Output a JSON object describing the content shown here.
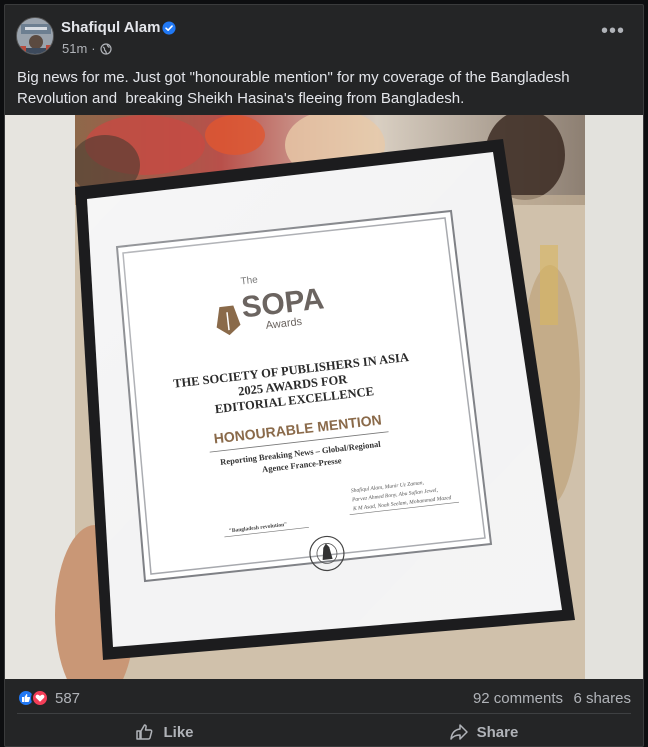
{
  "post": {
    "author": "Shafiqul Alam",
    "time": "51m",
    "separator": "·",
    "text": "Big news for me. Just got \"honourable mention\" for my coverage of the Bangladesh Revolution and  breaking Sheikh Hasina's fleeing from Bangladesh.",
    "more_label": "•••"
  },
  "certificate": {
    "brand_small": "The",
    "brand": "SOPA",
    "brand_sub": "Awards",
    "line1": "THE SOCIETY OF PUBLISHERS IN ASIA",
    "line2": "2025 AWARDS FOR",
    "line3": "EDITORIAL EXCELLENCE",
    "mention": "HONOURABLE MENTION",
    "category": "Reporting Breaking News – Global/Regional",
    "agency": "Agence France-Presse",
    "story": "\"Bangladesh revolution\"",
    "credits": [
      "Shafiqul Alam, Munir Uz Zaman,",
      "Parvez Ahmed Rony, Abu Sufian Jewel,",
      "K M Asad, Noah Seelam, Mohammad Mazed"
    ]
  },
  "stats": {
    "reaction_count": "587",
    "comments": "92 comments",
    "shares": "6 shares"
  },
  "actions": {
    "like": "Like",
    "share": "Share"
  },
  "colors": {
    "card_bg": "#242526",
    "accent_blue": "#2078f4",
    "love_red": "#f33e58",
    "text_secondary": "#b0b3b8"
  },
  "icons": [
    "verified-badge-icon",
    "globe-icon",
    "more-options-icon",
    "like-reaction-icon",
    "love-reaction-icon",
    "like-thumb-icon",
    "share-arrow-icon",
    "fountain-pen-logo-icon",
    "society-seal-icon"
  ]
}
